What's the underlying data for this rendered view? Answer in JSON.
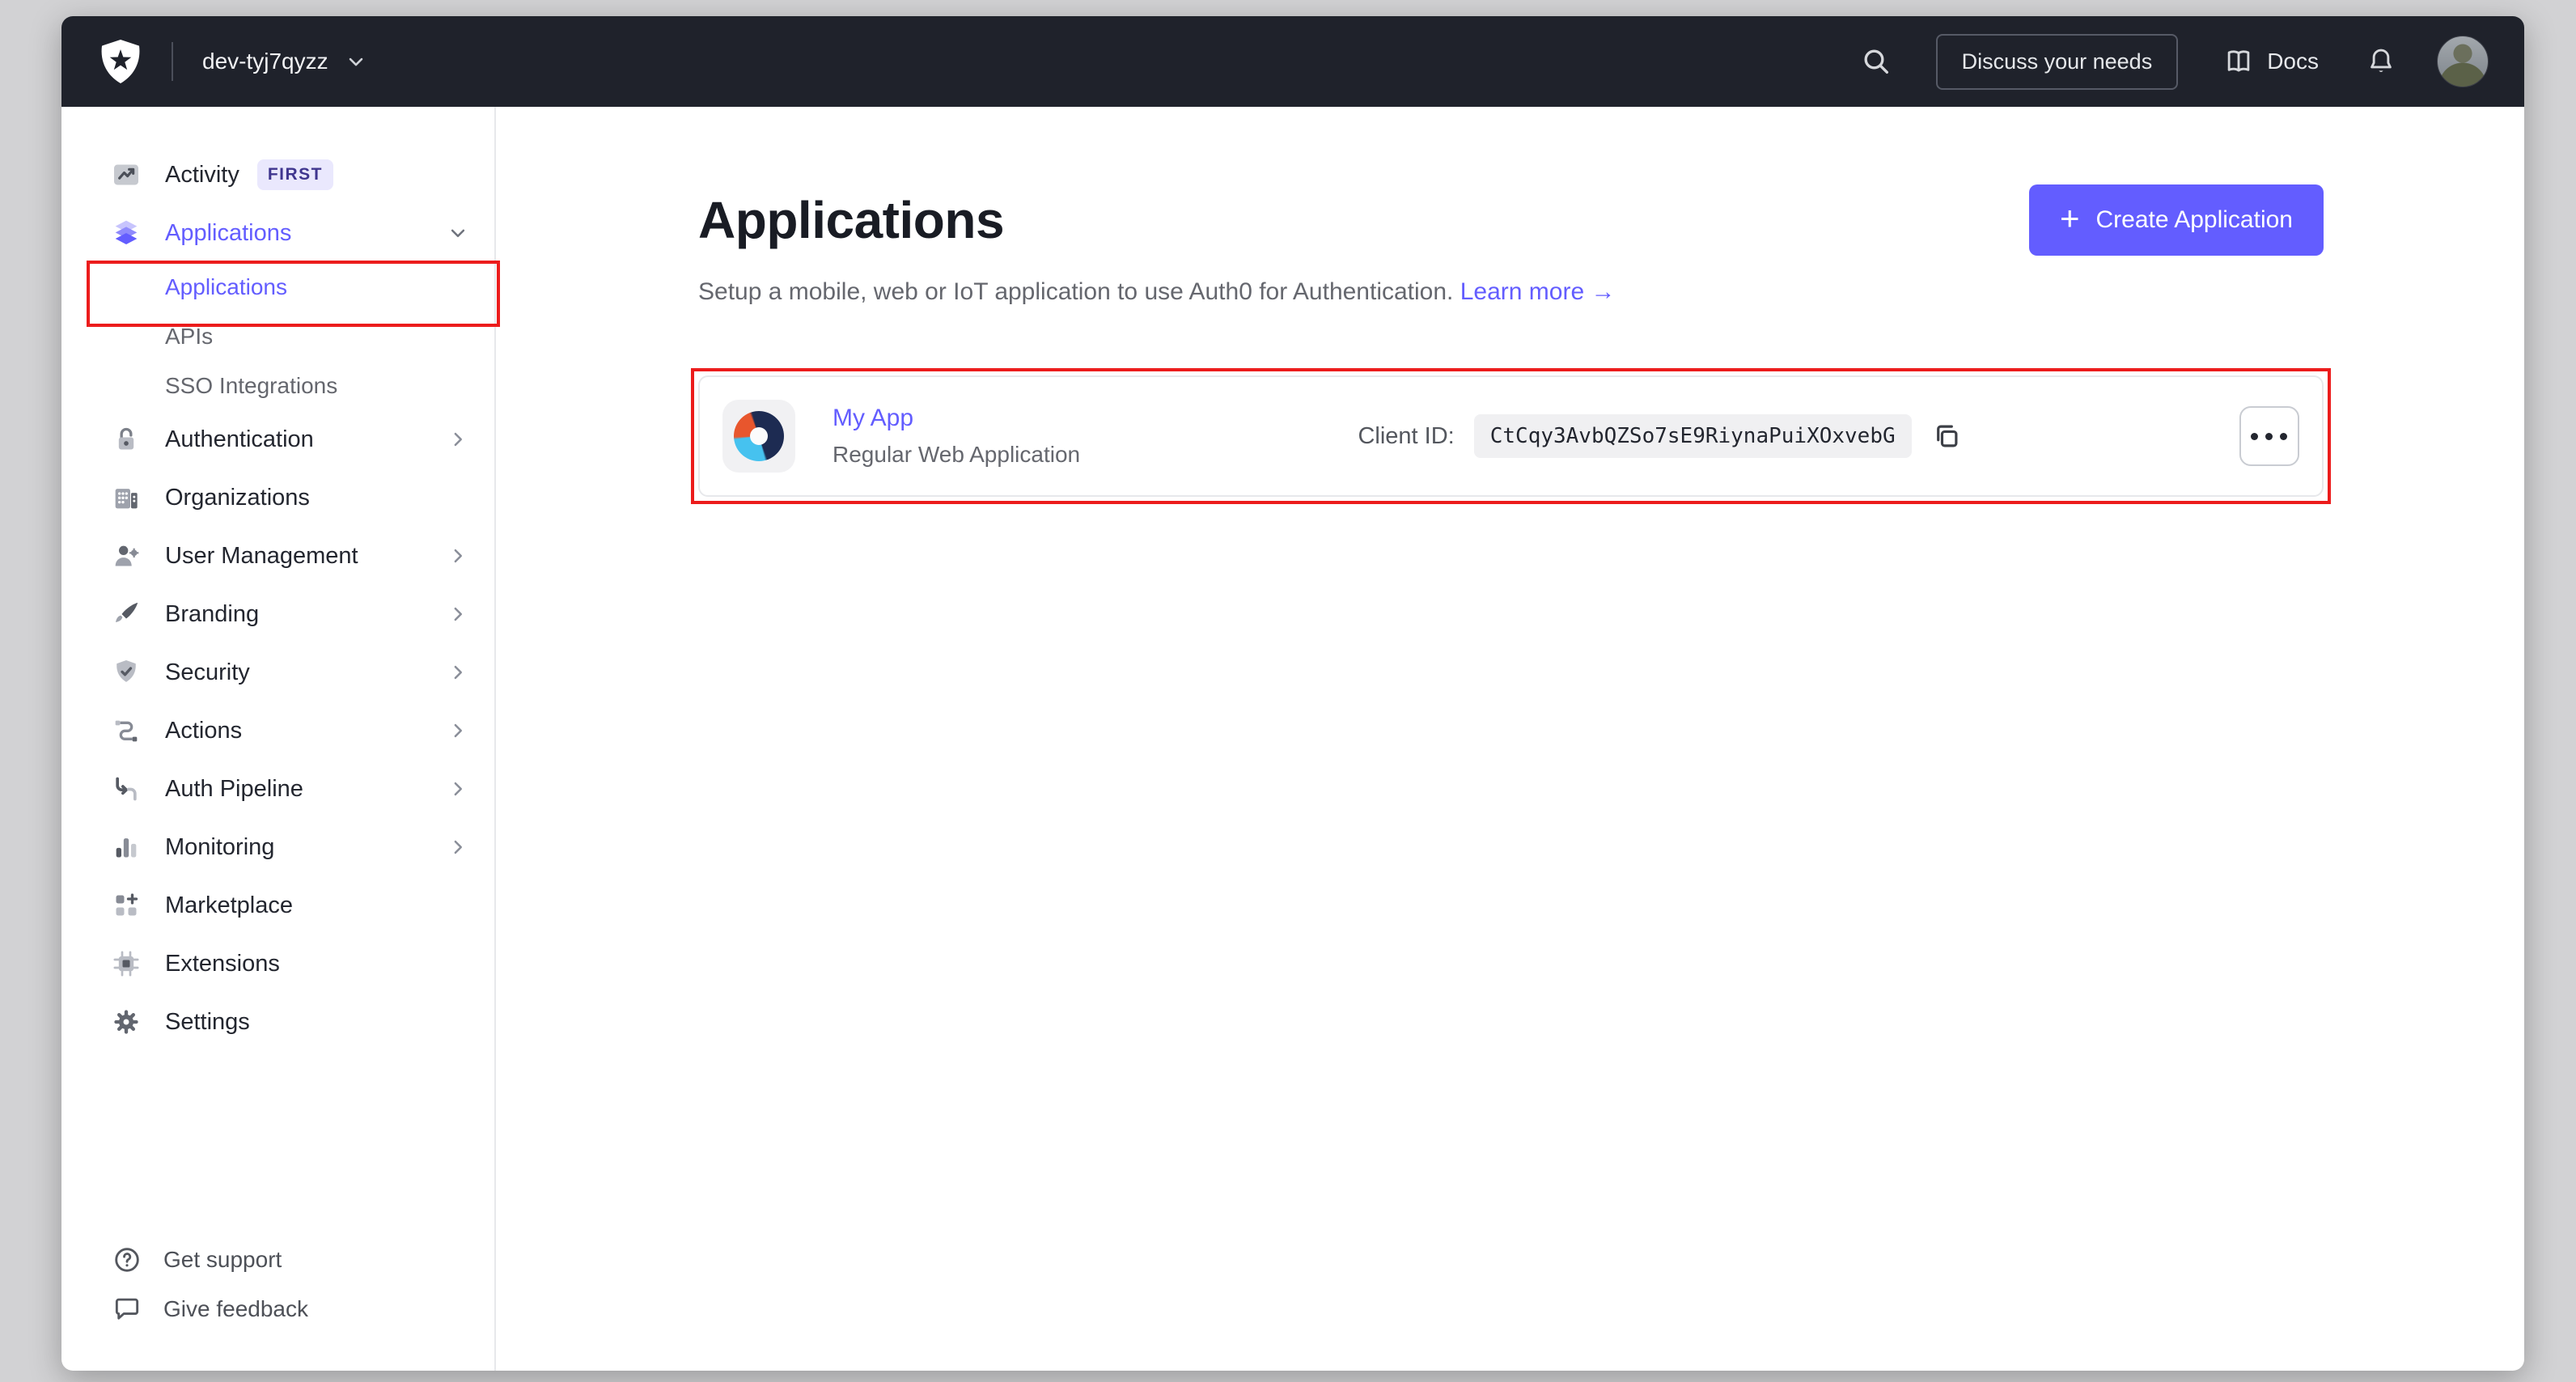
{
  "topbar": {
    "tenant": "dev-tyj7qyzz",
    "discuss_label": "Discuss your needs",
    "docs_label": "Docs"
  },
  "sidebar": {
    "items": [
      {
        "label": "Activity",
        "icon": "activity-icon",
        "badge": "FIRST"
      },
      {
        "label": "Applications",
        "icon": "applications-icon",
        "chevron": "down",
        "active": true
      },
      {
        "label": "Applications",
        "type": "sub",
        "active": true
      },
      {
        "label": "APIs",
        "type": "sub"
      },
      {
        "label": "SSO Integrations",
        "type": "sub"
      },
      {
        "label": "Authentication",
        "icon": "authentication-icon",
        "chevron": "right"
      },
      {
        "label": "Organizations",
        "icon": "organizations-icon"
      },
      {
        "label": "User Management",
        "icon": "user-management-icon",
        "chevron": "right"
      },
      {
        "label": "Branding",
        "icon": "branding-icon",
        "chevron": "right"
      },
      {
        "label": "Security",
        "icon": "security-icon",
        "chevron": "right"
      },
      {
        "label": "Actions",
        "icon": "actions-icon",
        "chevron": "right"
      },
      {
        "label": "Auth Pipeline",
        "icon": "auth-pipeline-icon",
        "chevron": "right"
      },
      {
        "label": "Monitoring",
        "icon": "monitoring-icon",
        "chevron": "right"
      },
      {
        "label": "Marketplace",
        "icon": "marketplace-icon"
      },
      {
        "label": "Extensions",
        "icon": "extensions-icon"
      },
      {
        "label": "Settings",
        "icon": "settings-icon"
      }
    ],
    "footer": [
      {
        "label": "Get support",
        "icon": "help-icon"
      },
      {
        "label": "Give feedback",
        "icon": "feedback-icon"
      }
    ]
  },
  "main": {
    "title": "Applications",
    "subtitle": "Setup a mobile, web or IoT application to use Auth0 for Authentication.",
    "learn_more_label": "Learn more",
    "create_button_label": "Create Application",
    "app": {
      "name": "My App",
      "type": "Regular Web Application",
      "client_id_label": "Client ID:",
      "client_id": "CtCqy3AvbQZSo7sE9RiynaPuiXOxvebG"
    }
  },
  "icons": {
    "plus": "+",
    "arrow_right": "→"
  },
  "colors": {
    "accent": "#635dff",
    "topbar_bg": "#1f222b",
    "annotation_red": "#ec1c1c"
  }
}
